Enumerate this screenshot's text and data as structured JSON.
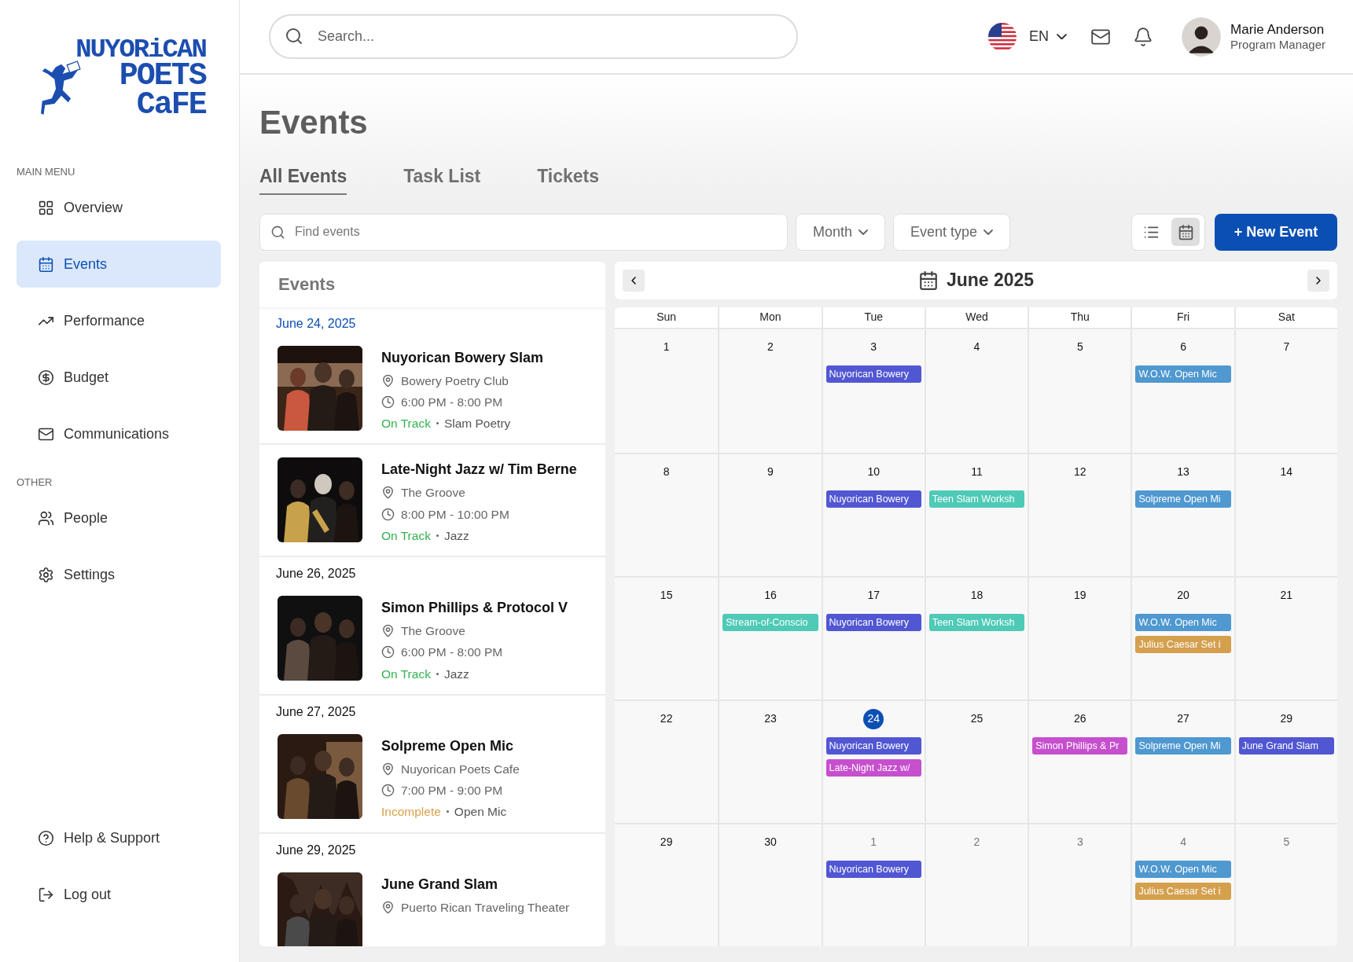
{
  "sidebar": {
    "logo": [
      "NUYORiCAN",
      "POETS",
      "CaFE"
    ],
    "sections": [
      {
        "heading": "MAIN MENU",
        "items": [
          {
            "label": "Overview",
            "selected": false
          },
          {
            "label": "Events",
            "selected": true
          },
          {
            "label": "Performance",
            "selected": false
          },
          {
            "label": "Budget",
            "selected": false
          },
          {
            "label": "Communications",
            "selected": false
          }
        ]
      },
      {
        "heading": "OTHER",
        "items": [
          {
            "label": "People",
            "selected": false
          },
          {
            "label": "Settings",
            "selected": false
          }
        ]
      }
    ],
    "footer_items": [
      {
        "label": "Help & Support"
      },
      {
        "label": "Log out"
      }
    ]
  },
  "header": {
    "search": {
      "placeholder": "Search..."
    },
    "language": "EN",
    "user": {
      "name": "Marie Anderson",
      "role": "Program Manager"
    }
  },
  "page": {
    "title": "Events",
    "tabs": [
      {
        "label": "All Events",
        "selected": true
      },
      {
        "label": "Task List",
        "selected": false
      },
      {
        "label": "Tickets",
        "selected": false
      }
    ]
  },
  "toolbar": {
    "find": {
      "placeholder": "Find events"
    },
    "filters": [
      "Month",
      "Event type"
    ],
    "views": [
      {
        "selected": false
      },
      {
        "selected": true
      }
    ],
    "new_button": "+ New Event"
  },
  "events_panel": {
    "title": "Events",
    "groups": [
      {
        "date": "June 24, 2025",
        "highlighted": true,
        "events": [
          {
            "title": "Nuyorican Bowery Slam",
            "venue": "Bowery Poetry Club",
            "time": "6:00 PM - 8:00 PM",
            "status": "On Track",
            "incomplete": false,
            "category": "Slam Poetry"
          },
          {
            "title": "Late-Night Jazz w/ Tim Berne",
            "venue": "The Groove",
            "time": "8:00 PM - 10:00 PM",
            "status": "On Track",
            "incomplete": false,
            "category": "Jazz"
          }
        ]
      },
      {
        "date": "June 26, 2025",
        "highlighted": false,
        "events": [
          {
            "title": "Simon Phillips & Protocol V",
            "venue": "The Groove",
            "time": "6:00 PM - 8:00 PM",
            "status": "On Track",
            "incomplete": false,
            "category": "Jazz"
          }
        ]
      },
      {
        "date": "June 27, 2025",
        "highlighted": false,
        "events": [
          {
            "title": "Solpreme Open Mic",
            "venue": "Nuyorican Poets Cafe",
            "time": "7:00 PM - 9:00 PM",
            "status": "Incomplete",
            "incomplete": true,
            "category": "Open Mic"
          }
        ]
      },
      {
        "date": "June 29, 2025",
        "highlighted": false,
        "events": [
          {
            "title": "June Grand Slam",
            "venue": "Puerto Rican Traveling Theater"
          }
        ]
      }
    ]
  },
  "calendar": {
    "month": "June 2025",
    "weekdays": [
      "Sun",
      "Mon",
      "Tue",
      "Wed",
      "Thu",
      "Fri",
      "Sat"
    ],
    "weeks": [
      [
        {
          "day": "1",
          "muted": false,
          "today": false
        },
        {
          "day": "2",
          "muted": false,
          "today": false
        },
        {
          "day": "3",
          "muted": false,
          "today": false,
          "events": [
            {
              "label": "Nuyorican Bowery",
              "color": "#5157d2"
            }
          ]
        },
        {
          "day": "4",
          "muted": false,
          "today": false
        },
        {
          "day": "5",
          "muted": false,
          "today": false
        },
        {
          "day": "6",
          "muted": false,
          "today": false,
          "events": [
            {
              "label": "W.O.W. Open Mic",
              "color": "#4f98d0"
            }
          ]
        },
        {
          "day": "7",
          "muted": false,
          "today": false
        }
      ],
      [
        {
          "day": "8",
          "muted": false,
          "today": false
        },
        {
          "day": "9",
          "muted": false,
          "today": false
        },
        {
          "day": "10",
          "muted": false,
          "today": false,
          "events": [
            {
              "label": "Nuyorican Bowery",
              "color": "#5157d2"
            }
          ]
        },
        {
          "day": "11",
          "muted": false,
          "today": false,
          "events": [
            {
              "label": "Teen Slam Worksh",
              "color": "#4ecab7"
            }
          ]
        },
        {
          "day": "12",
          "muted": false,
          "today": false
        },
        {
          "day": "13",
          "muted": false,
          "today": false,
          "events": [
            {
              "label": "Solpreme Open Mi",
              "color": "#4f98d0"
            }
          ]
        },
        {
          "day": "14",
          "muted": false,
          "today": false
        }
      ],
      [
        {
          "day": "15",
          "muted": false,
          "today": false
        },
        {
          "day": "16",
          "muted": false,
          "today": false,
          "events": [
            {
              "label": "Stream-of-Conscio",
              "color": "#4ecab7"
            }
          ]
        },
        {
          "day": "17",
          "muted": false,
          "today": false,
          "events": [
            {
              "label": "Nuyorican Bowery",
              "color": "#5157d2"
            }
          ]
        },
        {
          "day": "18",
          "muted": false,
          "today": false,
          "events": [
            {
              "label": "Teen Slam Worksh",
              "color": "#4ecab7"
            }
          ]
        },
        {
          "day": "19",
          "muted": false,
          "today": false
        },
        {
          "day": "20",
          "muted": false,
          "today": false,
          "events": [
            {
              "label": "W.O.W. Open Mic",
              "color": "#4f98d0"
            },
            {
              "label": "Julius Caesar Set i",
              "color": "#d4a04e"
            }
          ]
        },
        {
          "day": "21",
          "muted": false,
          "today": false
        }
      ],
      [
        {
          "day": "22",
          "muted": false,
          "today": false
        },
        {
          "day": "23",
          "muted": false,
          "today": false
        },
        {
          "day": "24",
          "muted": false,
          "today": true,
          "events": [
            {
              "label": "Nuyorican Bowery",
              "color": "#5157d2"
            },
            {
              "label": "Late-Night Jazz w/",
              "color": "#c64fce"
            }
          ]
        },
        {
          "day": "25",
          "muted": false,
          "today": false
        },
        {
          "day": "26",
          "muted": false,
          "today": false,
          "events": [
            {
              "label": "Simon Phillips & Pr",
              "color": "#c64fce"
            }
          ]
        },
        {
          "day": "27",
          "muted": false,
          "today": false,
          "events": [
            {
              "label": "Solpreme Open Mi",
              "color": "#4f98d0"
            }
          ]
        },
        {
          "day": "29",
          "muted": false,
          "today": false,
          "events": [
            {
              "label": "June Grand Slam",
              "color": "#5157d2"
            }
          ]
        }
      ],
      [
        {
          "day": "29",
          "muted": false,
          "today": false
        },
        {
          "day": "30",
          "muted": false,
          "today": false
        },
        {
          "day": "1",
          "muted": true,
          "today": false,
          "events": [
            {
              "label": "Nuyorican Bowery",
              "color": "#5157d2"
            }
          ]
        },
        {
          "day": "2",
          "muted": true,
          "today": false
        },
        {
          "day": "3",
          "muted": true,
          "today": false
        },
        {
          "day": "4",
          "muted": true,
          "today": false,
          "events": [
            {
              "label": "W.O.W. Open Mic",
              "color": "#4f98d0"
            },
            {
              "label": "Julius Caesar Set i",
              "color": "#d4a04e"
            }
          ]
        },
        {
          "day": "5",
          "muted": true,
          "today": false
        }
      ]
    ]
  }
}
